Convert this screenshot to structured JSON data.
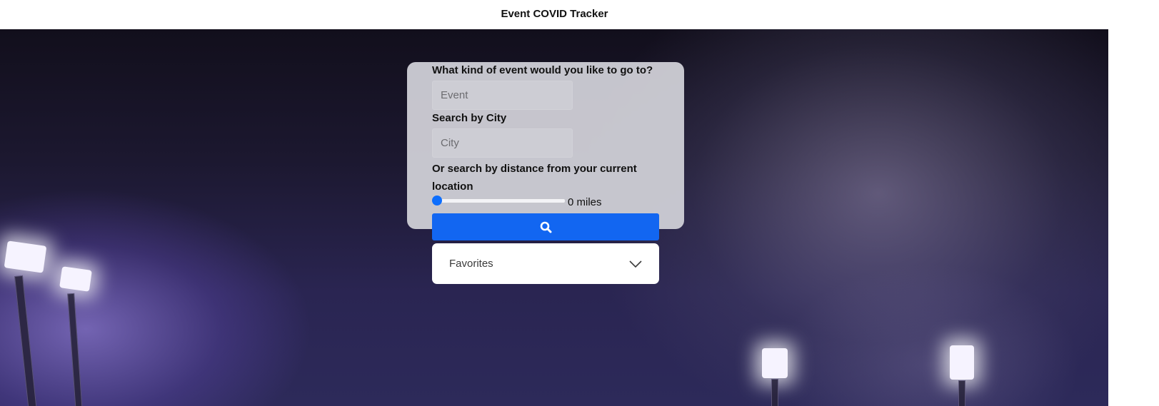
{
  "header": {
    "title": "Event COVID Tracker"
  },
  "search_form": {
    "event_label": "What kind of event would you like to go to?",
    "event_placeholder": "Event",
    "city_label": "Search by City",
    "city_placeholder": "City",
    "distance_label": "Or search by distance from your current location",
    "distance_value": 0,
    "distance_text": "0 miles",
    "search_icon": "search-icon"
  },
  "favorites": {
    "label": "Favorites",
    "icon": "chevron-down-icon"
  },
  "colors": {
    "accent": "#1266f1",
    "card_bg": "#cdcdd4",
    "header_bg": "#ffffff"
  },
  "background": {
    "image": "stadium-night-lights"
  }
}
